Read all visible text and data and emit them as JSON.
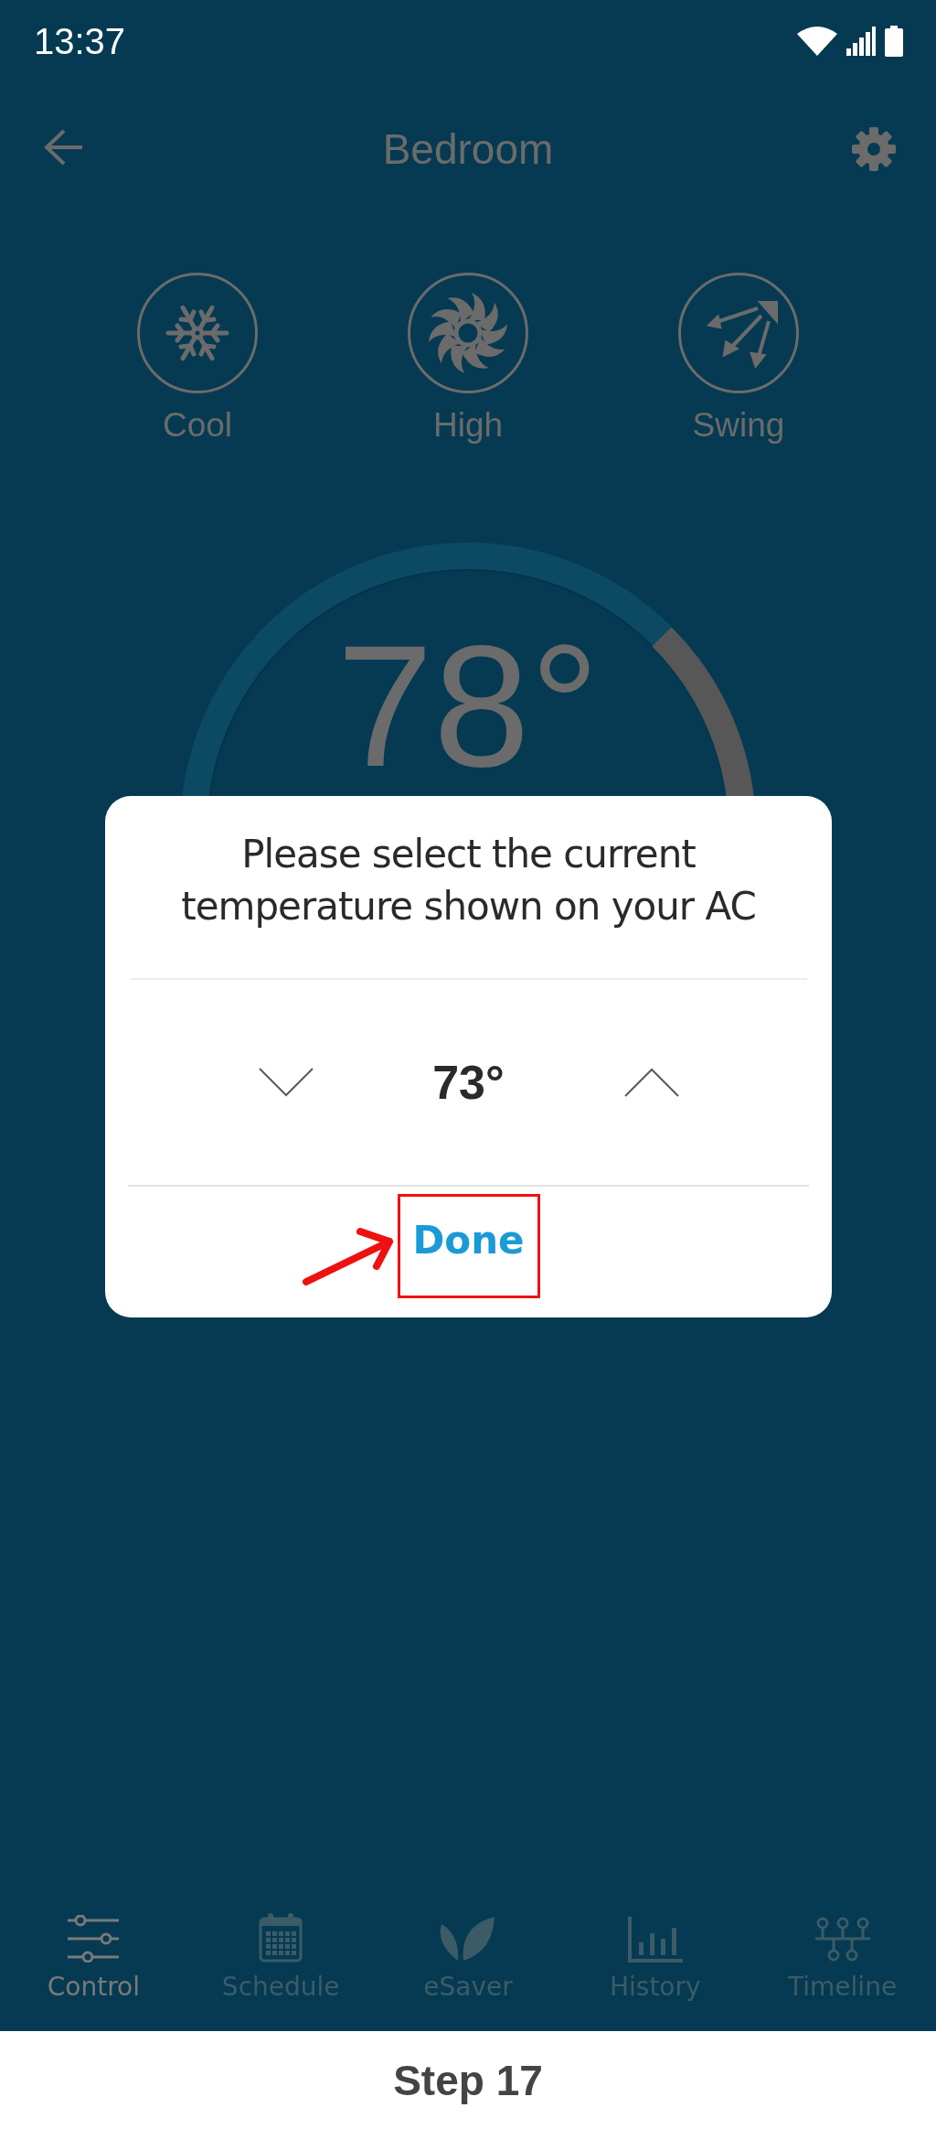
{
  "status_bar": {
    "time": "13:37"
  },
  "header": {
    "title": "Bedroom"
  },
  "modes": [
    {
      "kind": "cool",
      "label": "Cool"
    },
    {
      "kind": "fan",
      "label": "High"
    },
    {
      "kind": "swing",
      "label": "Swing"
    }
  ],
  "dial": {
    "temperature": "78°"
  },
  "dialog": {
    "title": "Please select the current temperature shown on your AC",
    "value": "73°",
    "done": "Done"
  },
  "nav": [
    {
      "kind": "control",
      "label": "Control",
      "selected": true
    },
    {
      "kind": "schedule",
      "label": "Schedule",
      "selected": false
    },
    {
      "kind": "esaver",
      "label": "eSaver",
      "selected": false
    },
    {
      "kind": "history",
      "label": "History",
      "selected": false
    },
    {
      "kind": "timeline",
      "label": "Timeline",
      "selected": false
    }
  ],
  "footer": {
    "caption": "Step 17"
  }
}
